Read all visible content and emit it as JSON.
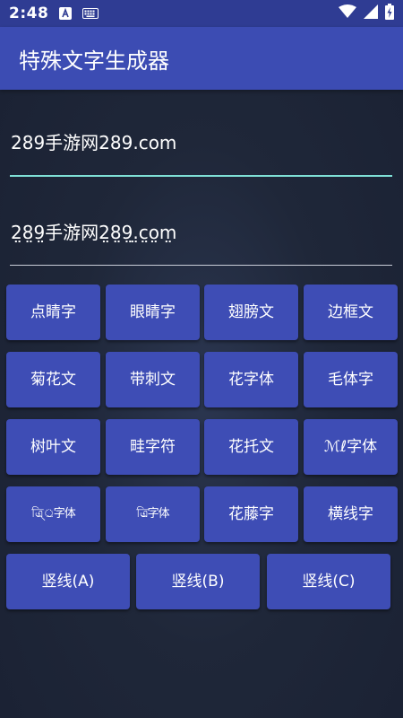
{
  "status_bar": {
    "time": "2:48",
    "icons": [
      "a-badge-icon",
      "keyboard-icon",
      "wifi-icon",
      "signal-icon",
      "battery-charging-icon"
    ]
  },
  "app_bar": {
    "title": "特殊文字生成器"
  },
  "input": {
    "value": "289手游网289.com"
  },
  "output": {
    "value": "2̤8̤9̤手游网2̤8̤9̤.̤c̤o̤m̤"
  },
  "buttons": {
    "row1": [
      "点睛字",
      "眼睛字",
      "翅膀文",
      "边框文"
    ],
    "row2": [
      "菊花文",
      "带刺文",
      "花字体",
      "毛体字"
    ],
    "row3": [
      "树叶文",
      "畦字符",
      "花托文",
      "ℳℓ字体"
    ],
    "row4": [
      "ত্র্রি্্ৰ字体",
      "ত্ৰ্ৰ্ৰ্ৰ্ৰি字体",
      "花藤字",
      "横线字"
    ],
    "row5": [
      "竖线(A)",
      "竖线(B)",
      "竖线(C)"
    ]
  },
  "colors": {
    "status_bar": "#2f3c93",
    "app_bar": "#3c4cb3",
    "button": "#3e4db5",
    "accent_underline": "#7fe0d6",
    "background": "#1f2739"
  }
}
